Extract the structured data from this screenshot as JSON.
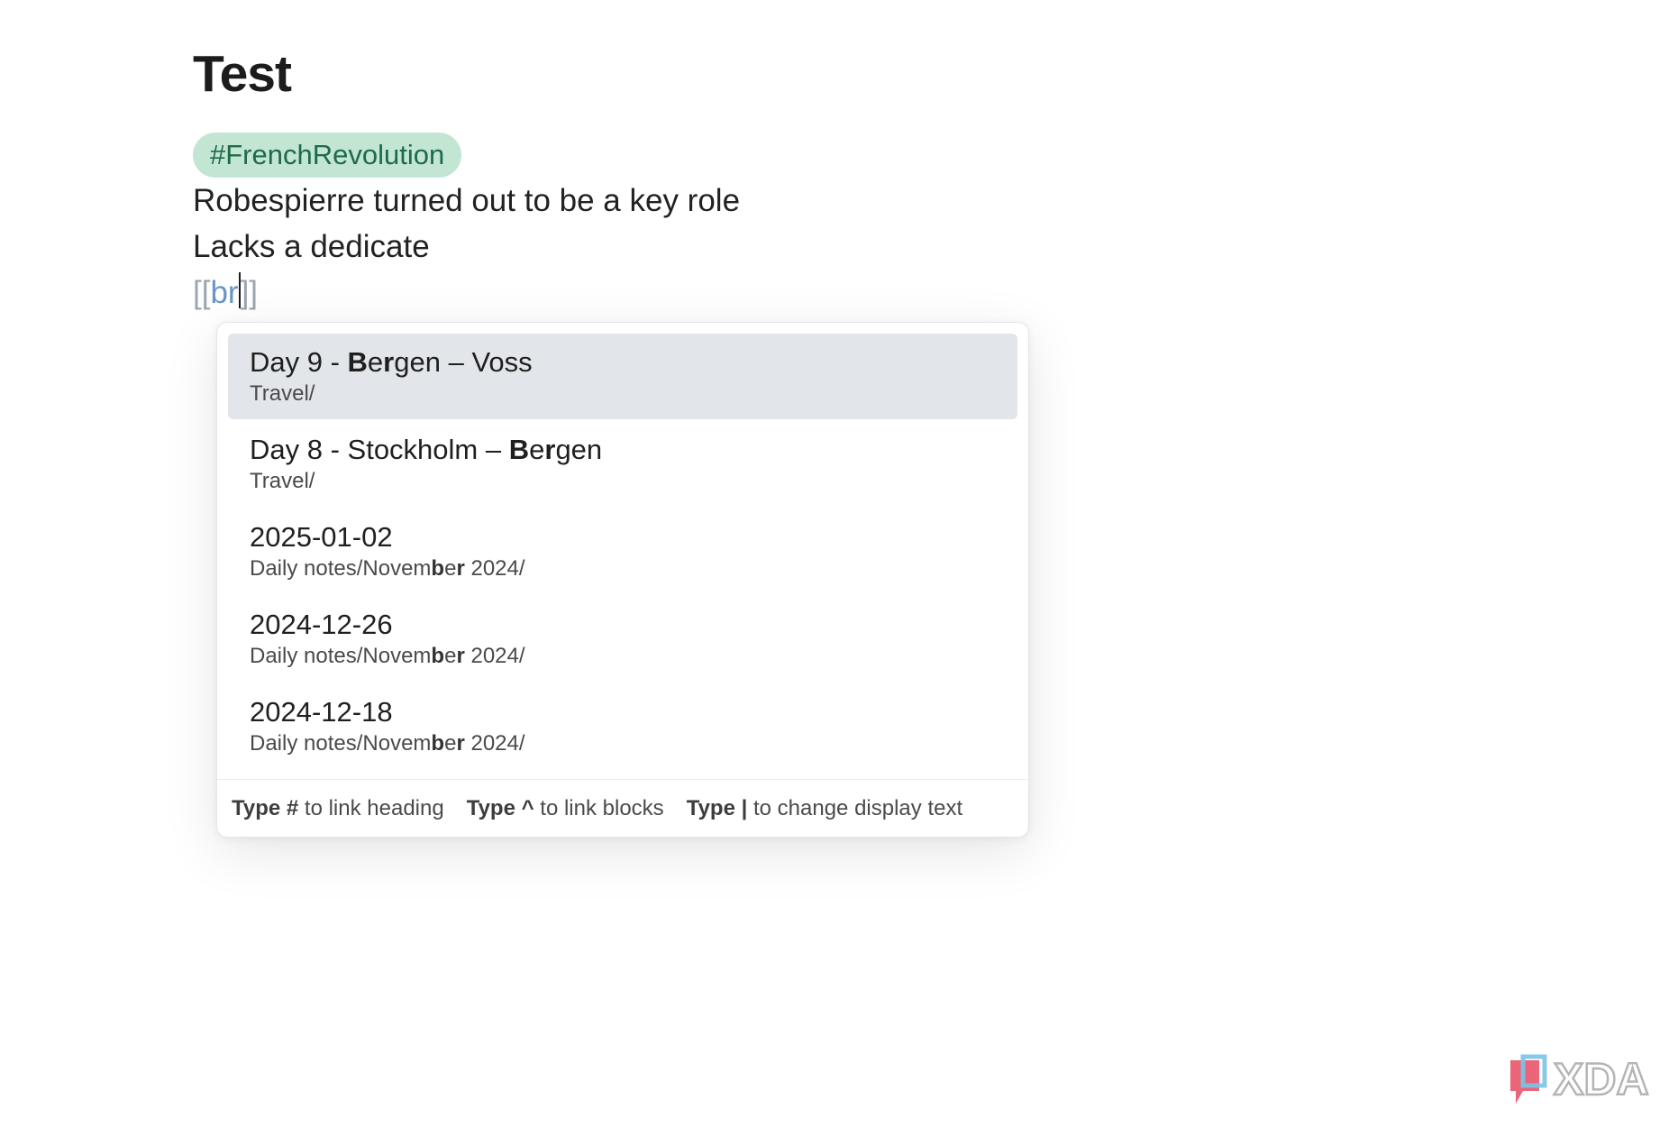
{
  "note": {
    "title": "Test",
    "tag": "#FrenchRevolution",
    "lines": [
      "Robespierre turned out to be a key role",
      "Lacks a dedicate"
    ],
    "link_input": {
      "open": "[[",
      "query": "br",
      "close": "]]"
    }
  },
  "suggestions": {
    "items": [
      {
        "title_parts": [
          {
            "t": "Day 9 - ",
            "b": false
          },
          {
            "t": "B",
            "b": true
          },
          {
            "t": "e",
            "b": false
          },
          {
            "t": "r",
            "b": true
          },
          {
            "t": "gen – Voss",
            "b": false
          }
        ],
        "path_parts": [
          {
            "t": "Travel/",
            "b": false
          }
        ],
        "selected": true
      },
      {
        "title_parts": [
          {
            "t": "Day 8 - Stockholm – ",
            "b": false
          },
          {
            "t": "B",
            "b": true
          },
          {
            "t": "e",
            "b": false
          },
          {
            "t": "r",
            "b": true
          },
          {
            "t": "gen",
            "b": false
          }
        ],
        "path_parts": [
          {
            "t": "Travel/",
            "b": false
          }
        ],
        "selected": false
      },
      {
        "title_parts": [
          {
            "t": "2025-01-02",
            "b": false
          }
        ],
        "path_parts": [
          {
            "t": "Daily notes/Novem",
            "b": false
          },
          {
            "t": "b",
            "b": true
          },
          {
            "t": "e",
            "b": false
          },
          {
            "t": "r",
            "b": true
          },
          {
            "t": " 2024/",
            "b": false
          }
        ],
        "selected": false
      },
      {
        "title_parts": [
          {
            "t": "2024-12-26",
            "b": false
          }
        ],
        "path_parts": [
          {
            "t": "Daily notes/Novem",
            "b": false
          },
          {
            "t": "b",
            "b": true
          },
          {
            "t": "e",
            "b": false
          },
          {
            "t": "r",
            "b": true
          },
          {
            "t": " 2024/",
            "b": false
          }
        ],
        "selected": false
      },
      {
        "title_parts": [
          {
            "t": "2024-12-18",
            "b": false
          }
        ],
        "path_parts": [
          {
            "t": "Daily notes/Novem",
            "b": false
          },
          {
            "t": "b",
            "b": true
          },
          {
            "t": "e",
            "b": false
          },
          {
            "t": "r",
            "b": true
          },
          {
            "t": " 2024/",
            "b": false
          }
        ],
        "selected": false
      }
    ],
    "footer_hints": [
      {
        "key": "Type #",
        "desc": " to link heading"
      },
      {
        "key": "Type ^",
        "desc": " to link blocks"
      },
      {
        "key": "Type |",
        "desc": " to change display text"
      }
    ]
  },
  "watermark": {
    "text": "XDA",
    "colors": {
      "red": "#e8495f",
      "blue": "#7ac4e6",
      "gray": "#b5b5b5"
    }
  },
  "colors": {
    "tag_bg": "#c3e6d4",
    "tag_text": "#1f6b46",
    "link_query": "#6b94c8",
    "selected_bg": "#e2e5e9"
  }
}
